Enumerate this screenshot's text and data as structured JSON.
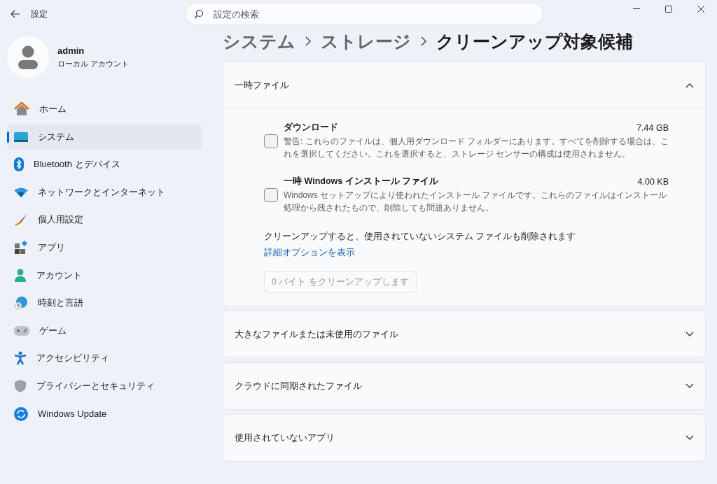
{
  "app": {
    "title": "設定"
  },
  "search": {
    "placeholder": "設定の検索"
  },
  "user": {
    "name": "admin",
    "account": "ローカル アカウント"
  },
  "nav": [
    {
      "label": "ホーム",
      "selected": false
    },
    {
      "label": "システム",
      "selected": true
    },
    {
      "label": "Bluetooth とデバイス",
      "selected": false
    },
    {
      "label": "ネットワークとインターネット",
      "selected": false
    },
    {
      "label": "個人用設定",
      "selected": false
    },
    {
      "label": "アプリ",
      "selected": false
    },
    {
      "label": "アカウント",
      "selected": false
    },
    {
      "label": "時刻と言語",
      "selected": false
    },
    {
      "label": "ゲーム",
      "selected": false
    },
    {
      "label": "アクセシビリティ",
      "selected": false
    },
    {
      "label": "プライバシーとセキュリティ",
      "selected": false
    },
    {
      "label": "Windows Update",
      "selected": false
    }
  ],
  "breadcrumb": [
    "システム",
    "ストレージ",
    "クリーンアップ対象候補"
  ],
  "sections": [
    {
      "title": "一時ファイル",
      "expanded": true,
      "files": [
        {
          "name": "ダウンロード",
          "size": "7.44 GB",
          "description": "警告: これらのファイルは、個人用ダウンロード フォルダーにあります。すべてを削除する場合は、これを選択してください。これを選択すると、ストレージ センサーの構成は使用されません。",
          "checked": false
        },
        {
          "name": "一時 Windows インストール ファイル",
          "size": "4.00 KB",
          "description": "Windows セットアップにより使われたインストール ファイルです。これらのファイルはインストール処理から残されたもので、削除しても問題ありません。",
          "checked": false
        }
      ],
      "note": "クリーンアップすると、使用されていないシステム ファイルも削除されます",
      "link": "詳細オプションを表示",
      "cleanup_button": {
        "label": "0 バイト をクリーンアップします",
        "disabled": true
      }
    },
    {
      "title": "大きなファイルまたは未使用のファイル",
      "expanded": false
    },
    {
      "title": "クラウドに同期されたファイル",
      "expanded": false
    },
    {
      "title": "使用されていないアプリ",
      "expanded": false
    }
  ]
}
